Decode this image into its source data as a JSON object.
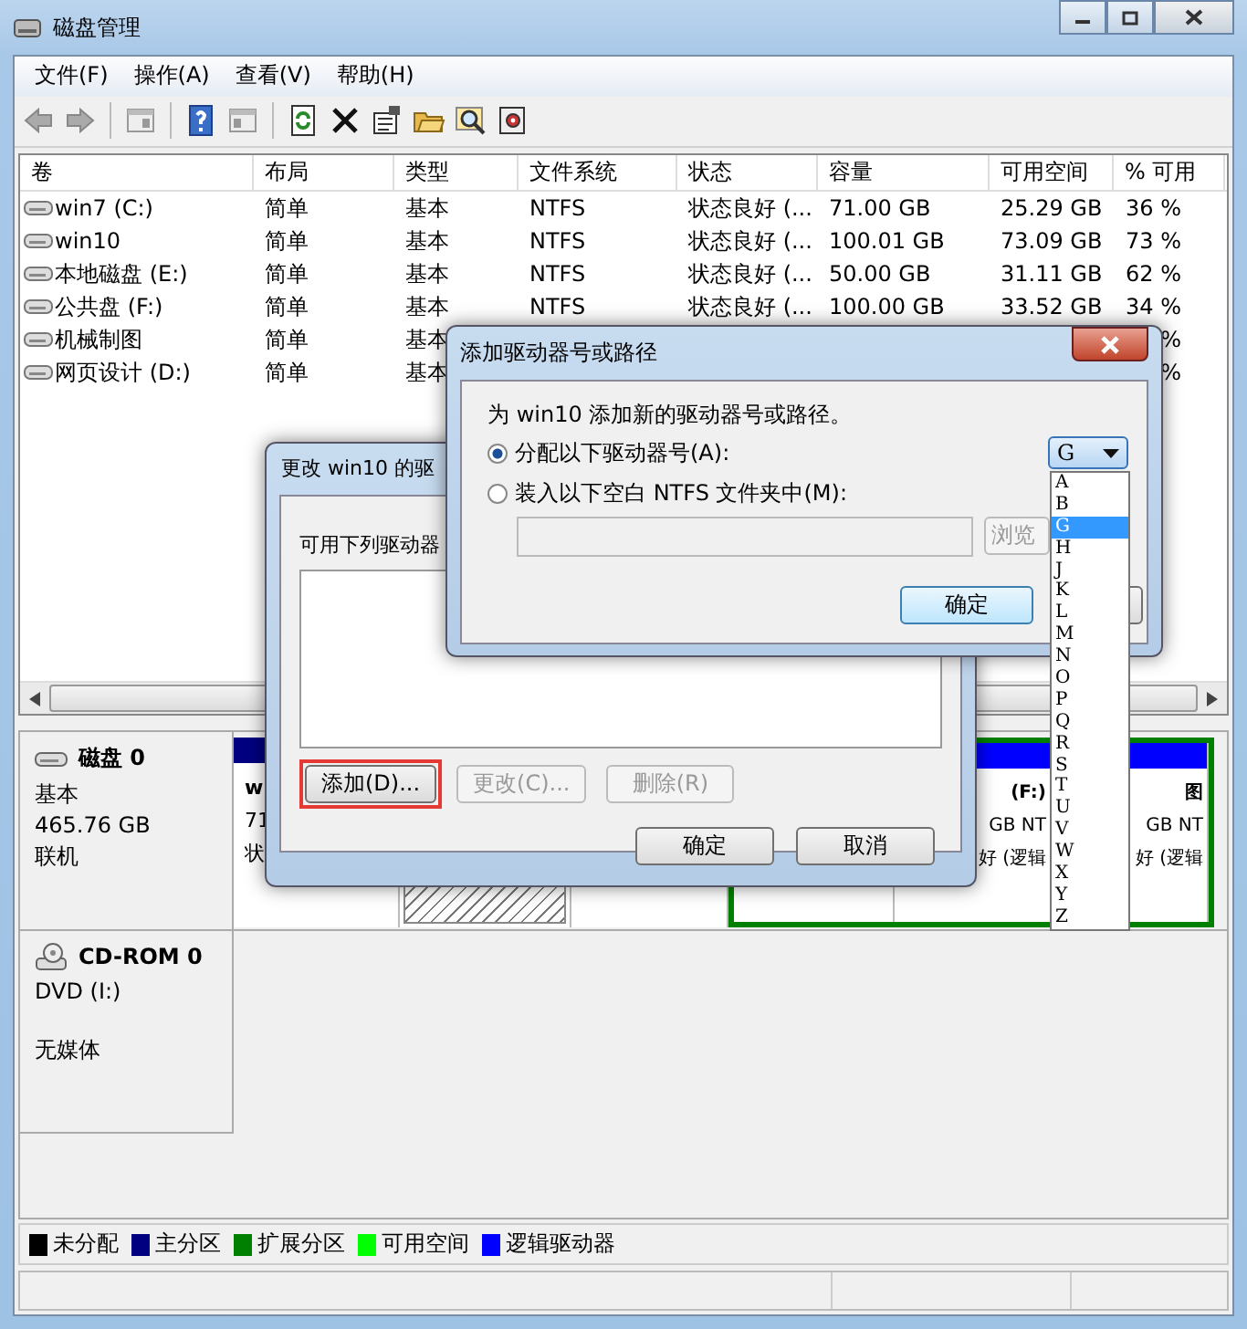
{
  "window": {
    "title": "磁盘管理"
  },
  "menu": [
    "文件(F)",
    "操作(A)",
    "查看(V)",
    "帮助(H)"
  ],
  "table": {
    "columns": [
      "卷",
      "布局",
      "类型",
      "文件系统",
      "状态",
      "容量",
      "可用空间",
      "% 可用"
    ],
    "rows": [
      {
        "volume": "win7 (C:)",
        "layout": "简单",
        "type": "基本",
        "fs": "NTFS",
        "status": "状态良好 (...",
        "capacity": "71.00 GB",
        "free": "25.29 GB",
        "pct": "36 %"
      },
      {
        "volume": "win10",
        "layout": "简单",
        "type": "基本",
        "fs": "NTFS",
        "status": "状态良好 (...",
        "capacity": "100.01 GB",
        "free": "73.09 GB",
        "pct": "73 %"
      },
      {
        "volume": "本地磁盘 (E:)",
        "layout": "简单",
        "type": "基本",
        "fs": "NTFS",
        "status": "状态良好 (...",
        "capacity": "50.00 GB",
        "free": "31.11 GB",
        "pct": "62 %"
      },
      {
        "volume": "公共盘 (F:)",
        "layout": "简单",
        "type": "基本",
        "fs": "NTFS",
        "status": "状态良好 (...",
        "capacity": "100.00 GB",
        "free": "33.52 GB",
        "pct": "34 %"
      },
      {
        "volume": "机械制图",
        "layout": "简单",
        "type": "基本",
        "pct": "%"
      },
      {
        "volume": "网页设计 (D:)",
        "layout": "简单",
        "type": "基本",
        "pct": "%"
      }
    ]
  },
  "disks": [
    {
      "kind": "disk",
      "name": "磁盘 0",
      "lines": [
        "基本",
        "465.76 GB",
        "联机"
      ],
      "partitions": [
        {
          "kind": "primary",
          "color": "#000080",
          "selected": false,
          "lines": [
            "w",
            "71",
            "状"
          ]
        },
        {
          "kind": "primary",
          "selected": true
        },
        {
          "kind": "primary",
          "selected": false
        },
        {
          "kind": "extended",
          "color": "#008000",
          "children": [
            {
              "selected": false
            },
            {
              "color": "#0000ff",
              "selected": false,
              "lines": [
                "(F:)",
                "GB NT",
                "好 (逻辑"
              ]
            },
            {
              "color": "#0000ff",
              "selected": false,
              "lines": [
                "图",
                "GB NT",
                "好 (逻辑"
              ]
            }
          ]
        }
      ]
    },
    {
      "kind": "cdrom",
      "name": "CD-ROM 0",
      "lines": [
        "DVD (I:)"
      ],
      "status": "无媒体"
    }
  ],
  "legend": [
    {
      "label": "未分配",
      "color": "#000000"
    },
    {
      "label": "主分区",
      "color": "#000080"
    },
    {
      "label": "扩展分区",
      "color": "#008000"
    },
    {
      "label": "可用空间",
      "color": "#00ff00"
    },
    {
      "label": "逻辑驱动器",
      "color": "#0000ff"
    }
  ],
  "change_dialog": {
    "title": "更改 win10 的驱",
    "list_label": "可用下列驱动器",
    "buttons": [
      {
        "label": "添加(D)...",
        "disabled": false,
        "highlighted": true
      },
      {
        "label": "更改(C)...",
        "disabled": true,
        "highlighted": false
      },
      {
        "label": "删除(R)",
        "disabled": true,
        "highlighted": false
      }
    ],
    "ok": "确定",
    "cancel": "取消"
  },
  "add_dialog": {
    "title": "添加驱动器号或路径",
    "prompt": "为 win10 添加新的驱动器号或路径。",
    "options": [
      {
        "label": "分配以下驱动器号(A):",
        "selected": true
      },
      {
        "label": "装入以下空白 NTFS 文件夹中(M):",
        "selected": false
      }
    ],
    "letter": "G",
    "browse": "浏览",
    "ok": "确定"
  },
  "dropdown": [
    {
      "label": "A",
      "selected": false
    },
    {
      "label": "B",
      "selected": false
    },
    {
      "label": "G",
      "selected": true
    },
    {
      "label": "H",
      "selected": false
    },
    {
      "label": "J",
      "selected": false
    },
    {
      "label": "K",
      "selected": false
    },
    {
      "label": "L",
      "selected": false
    },
    {
      "label": "M",
      "selected": false
    },
    {
      "label": "N",
      "selected": false
    },
    {
      "label": "O",
      "selected": false
    },
    {
      "label": "P",
      "selected": false
    },
    {
      "label": "Q",
      "selected": false
    },
    {
      "label": "R",
      "selected": false
    },
    {
      "label": "S",
      "selected": false
    },
    {
      "label": "T",
      "selected": false
    },
    {
      "label": "U",
      "selected": false
    },
    {
      "label": "V",
      "selected": false
    },
    {
      "label": "W",
      "selected": false
    },
    {
      "label": "X",
      "selected": false
    },
    {
      "label": "Y",
      "selected": false
    },
    {
      "label": "Z",
      "selected": false
    }
  ]
}
